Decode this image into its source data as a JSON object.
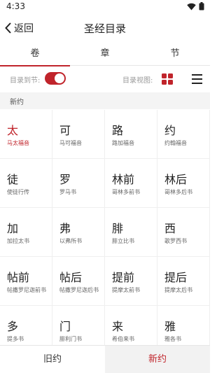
{
  "status": {
    "time": "4:33"
  },
  "nav": {
    "back_label": "返回",
    "title": "圣经目录"
  },
  "tabs": [
    {
      "label": "卷",
      "active": true
    },
    {
      "label": "章",
      "active": false
    },
    {
      "label": "节",
      "active": false
    }
  ],
  "toolbar": {
    "jump_label": "目录到节:",
    "jump_enabled": true,
    "view_label": "目录视图:"
  },
  "section": {
    "title": "新约"
  },
  "books": [
    {
      "short": "太",
      "full": "马太福音",
      "selected": true
    },
    {
      "short": "可",
      "full": "马可福音"
    },
    {
      "short": "路",
      "full": "路加福音"
    },
    {
      "short": "约",
      "full": "约翰福音"
    },
    {
      "short": "徒",
      "full": "使徒行传"
    },
    {
      "short": "罗",
      "full": "罗马书"
    },
    {
      "short": "林前",
      "full": "哥林多前书"
    },
    {
      "short": "林后",
      "full": "哥林多后书"
    },
    {
      "short": "加",
      "full": "加拉太书"
    },
    {
      "short": "弗",
      "full": "以弗所书"
    },
    {
      "short": "腓",
      "full": "腓立比书"
    },
    {
      "short": "西",
      "full": "歌罗西书"
    },
    {
      "short": "帖前",
      "full": "帖撒罗尼迦前书"
    },
    {
      "short": "帖后",
      "full": "帖撒罗尼迦后书"
    },
    {
      "short": "提前",
      "full": "提摩太前书"
    },
    {
      "short": "提后",
      "full": "提摩太后书"
    },
    {
      "short": "多",
      "full": "提多书"
    },
    {
      "short": "门",
      "full": "腓利门书"
    },
    {
      "short": "来",
      "full": "希伯来书"
    },
    {
      "short": "雅",
      "full": "雅各书"
    }
  ],
  "bottom": {
    "old_label": "旧约",
    "new_label": "新约",
    "active": "new"
  },
  "colors": {
    "accent": "#c0242b"
  },
  "icons": {
    "back": "chevron-left-icon",
    "grid": "grid-view-icon",
    "list": "list-view-icon"
  }
}
